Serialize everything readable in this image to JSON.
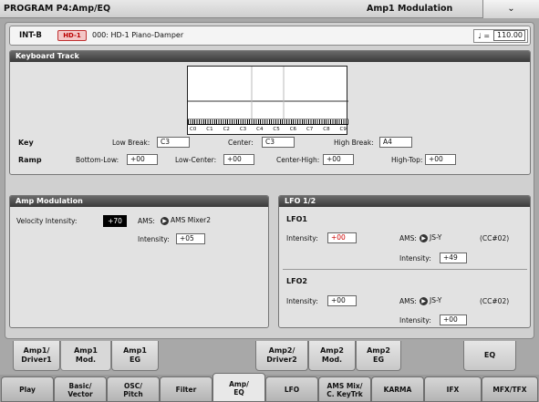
{
  "header": {
    "title": "PROGRAM P4:Amp/EQ",
    "page": "Amp1 Modulation",
    "menu_icon": "chevron-down-icon"
  },
  "program": {
    "bank": "INT-B",
    "badge": "HD-1",
    "name": "000: HD-1 Piano-Damper",
    "tempo_note": "♩ =",
    "tempo": "110.00"
  },
  "keyboard_track": {
    "title": "Keyboard Track",
    "octave_labels": [
      "C0",
      "C1",
      "C2",
      "C3",
      "C4",
      "C5",
      "C6",
      "C7",
      "C8",
      "C9"
    ],
    "key_label": "Key",
    "low_break_label": "Low Break:",
    "low_break": "C3",
    "center_label": "Center:",
    "center": "C3",
    "high_break_label": "High Break:",
    "high_break": "A4",
    "ramp_label": "Ramp",
    "bottom_low_label": "Bottom-Low:",
    "bottom_low": "+00",
    "low_center_label": "Low-Center:",
    "low_center": "+00",
    "center_high_label": "Center-High:",
    "center_high": "+00",
    "high_top_label": "High-Top:",
    "high_top": "+00"
  },
  "amp_mod": {
    "title": "Amp Modulation",
    "velocity_label": "Velocity Intensity:",
    "velocity": "+70",
    "ams_label": "AMS:",
    "ams": "AMS Mixer2",
    "intensity_label": "Intensity:",
    "intensity": "+05"
  },
  "lfo": {
    "title": "LFO 1/2",
    "lfo1": {
      "name": "LFO1",
      "intensity_label": "Intensity:",
      "intensity": "+00",
      "ams_label": "AMS:",
      "ams": "JS-Y",
      "cc": "(CC#02)",
      "ams_int_label": "Intensity:",
      "ams_int": "+49"
    },
    "lfo2": {
      "name": "LFO2",
      "intensity_label": "Intensity:",
      "intensity": "+00",
      "ams_label": "AMS:",
      "ams": "JS-Y",
      "cc": "(CC#02)",
      "ams_int_label": "Intensity:",
      "ams_int": "+00"
    }
  },
  "subtabs": [
    {
      "line1": "Amp1/",
      "line2": "Driver1"
    },
    {
      "line1": "Amp1",
      "line2": "Mod."
    },
    {
      "line1": "Amp1",
      "line2": "EG"
    },
    {
      "line1": "Amp2/",
      "line2": "Driver2"
    },
    {
      "line1": "Amp2",
      "line2": "Mod."
    },
    {
      "line1": "Amp2",
      "line2": "EG"
    },
    {
      "line1": "EQ",
      "line2": ""
    }
  ],
  "maintabs": [
    {
      "line1": "Play",
      "line2": ""
    },
    {
      "line1": "Basic/",
      "line2": "Vector"
    },
    {
      "line1": "OSC/",
      "line2": "Pitch"
    },
    {
      "line1": "Filter",
      "line2": ""
    },
    {
      "line1": "Amp/",
      "line2": "EQ"
    },
    {
      "line1": "LFO",
      "line2": ""
    },
    {
      "line1": "AMS Mix/",
      "line2": "C. KeyTrk"
    },
    {
      "line1": "KARMA",
      "line2": ""
    },
    {
      "line1": "IFX",
      "line2": ""
    },
    {
      "line1": "MFX/TFX",
      "line2": ""
    }
  ]
}
